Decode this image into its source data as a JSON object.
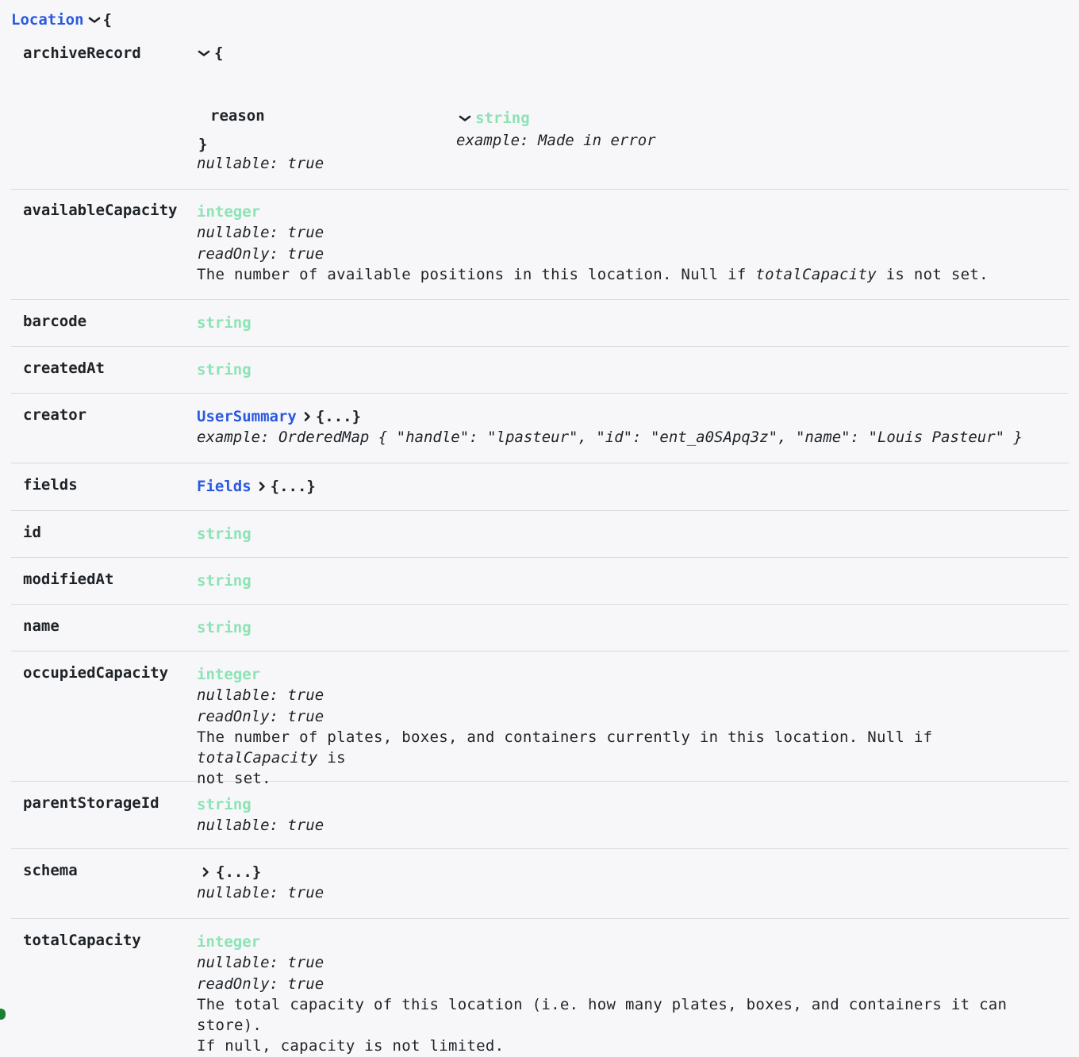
{
  "model": {
    "name": "Location",
    "open_brace": "{"
  },
  "rows": [
    {
      "name": "archiveRecord",
      "brace_open": "{",
      "brace_close": "}",
      "nullable_label": "nullable:",
      "nullable_value": "true",
      "nested": {
        "name": "reason",
        "type": "string",
        "example_label": "example:",
        "example_value": "Made in error"
      }
    },
    {
      "name": "availableCapacity",
      "type": "integer",
      "nullable_label": "nullable:",
      "nullable_value": "true",
      "readonly_label": "readOnly:",
      "readonly_value": "true",
      "desc_pre": "The number of available positions in this location. Null if ",
      "desc_em": "totalCapacity",
      "desc_post": " is not set."
    },
    {
      "name": "barcode",
      "type": "string"
    },
    {
      "name": "createdAt",
      "type": "string"
    },
    {
      "name": "creator",
      "ref": "UserSummary",
      "collapsed": "{...}",
      "example_label": "example:",
      "example_value": "OrderedMap { \"handle\": \"lpasteur\", \"id\": \"ent_a0SApq3z\", \"name\": \"Louis Pasteur\" }"
    },
    {
      "name": "fields",
      "ref": "Fields",
      "collapsed": "{...}"
    },
    {
      "name": "id",
      "type": "string"
    },
    {
      "name": "modifiedAt",
      "type": "string"
    },
    {
      "name": "name",
      "type": "string"
    },
    {
      "name": "occupiedCapacity",
      "type": "integer",
      "nullable_label": "nullable:",
      "nullable_value": "true",
      "readonly_label": "readOnly:",
      "readonly_value": "true",
      "desc_pre": "The number of plates, boxes, and containers currently in this location. Null if ",
      "desc_em": "totalCapacity",
      "desc_post": " is",
      "desc_line2": "not set."
    },
    {
      "name": "parentStorageId",
      "type": "string",
      "nullable_label": "nullable:",
      "nullable_value": "true"
    },
    {
      "name": "schema",
      "collapsed": "{...}",
      "nullable_label": "nullable:",
      "nullable_value": "true"
    },
    {
      "name": "totalCapacity",
      "type": "integer",
      "nullable_label": "nullable:",
      "nullable_value": "true",
      "readonly_label": "readOnly:",
      "readonly_value": "true",
      "desc_line1": "The total capacity of this location (i.e. how many plates, boxes, and containers it can store).",
      "desc_line2": "If null, capacity is not limited."
    }
  ],
  "colors": {
    "link": "#2a59e0",
    "type": "#8de3b5",
    "border": "#d9dbe0",
    "background": "#f7f7f9",
    "status_dot": "#1a7f2e"
  },
  "icons": {
    "expanded": "chevron-down-icon",
    "collapsed": "chevron-right-icon"
  }
}
